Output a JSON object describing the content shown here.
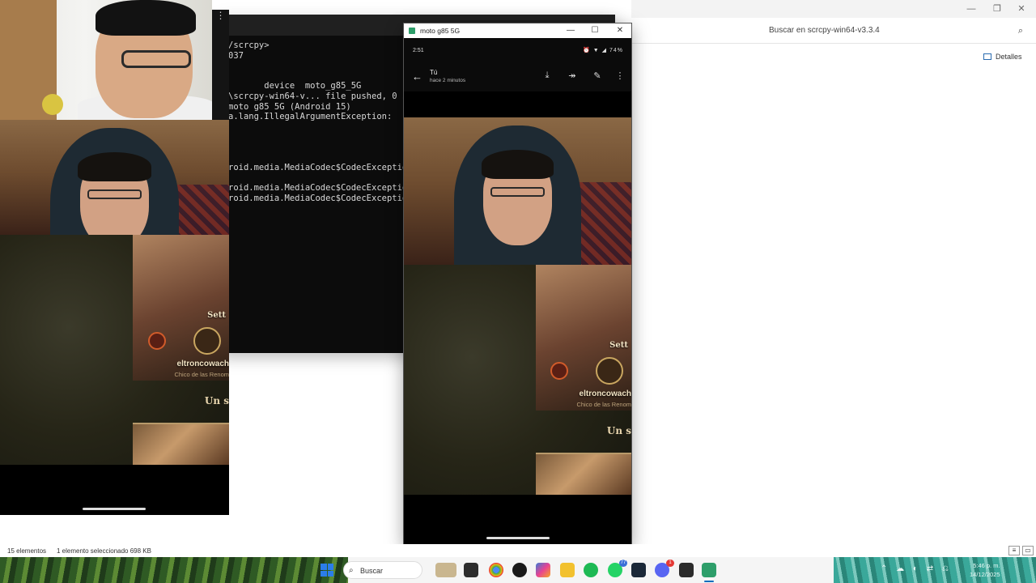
{
  "explorer": {
    "search_placeholder": "Buscar en scrcpy-win64-v3.3.4",
    "details_label": "Detalles",
    "status_items": "15 elementos",
    "status_selected": "1 elemento seleccionado  698 KB"
  },
  "terminal": {
    "lines": "/scrcpy>\n037\n\n\n       device  moto_g85_5G\n\\scrcpy-win64-v... file pushed, 0 sk\nmoto g85 5G (Android 15)\na.lang.IllegalArgumentException:\n\n\n\n\nroid.media.MediaCodec$CodecException\n\nroid.media.MediaCodec$CodecException\nroid.media.MediaCodec$CodecException"
  },
  "phone_window": {
    "title": "moto g85 5G",
    "status_time": "2:51",
    "status_battery": "74%",
    "sender": "Tú",
    "sent_ago": "hace 2 minutos",
    "icons": [
      "back-arrow-icon",
      "download-icon",
      "forward-icon",
      "edit-icon",
      "more-vert-icon"
    ]
  },
  "game_card": {
    "champion": "Sett",
    "player": "eltroncowach",
    "subtitle": "Chico de las Renom",
    "partial_text": "Un s"
  },
  "taskbar": {
    "search_label": "Buscar",
    "badge_whatsapp": "77",
    "badge_discord": "1",
    "clock_time": "5:46 p. m.",
    "clock_date": "14/12/2025",
    "accent": "#0f6cbd"
  }
}
